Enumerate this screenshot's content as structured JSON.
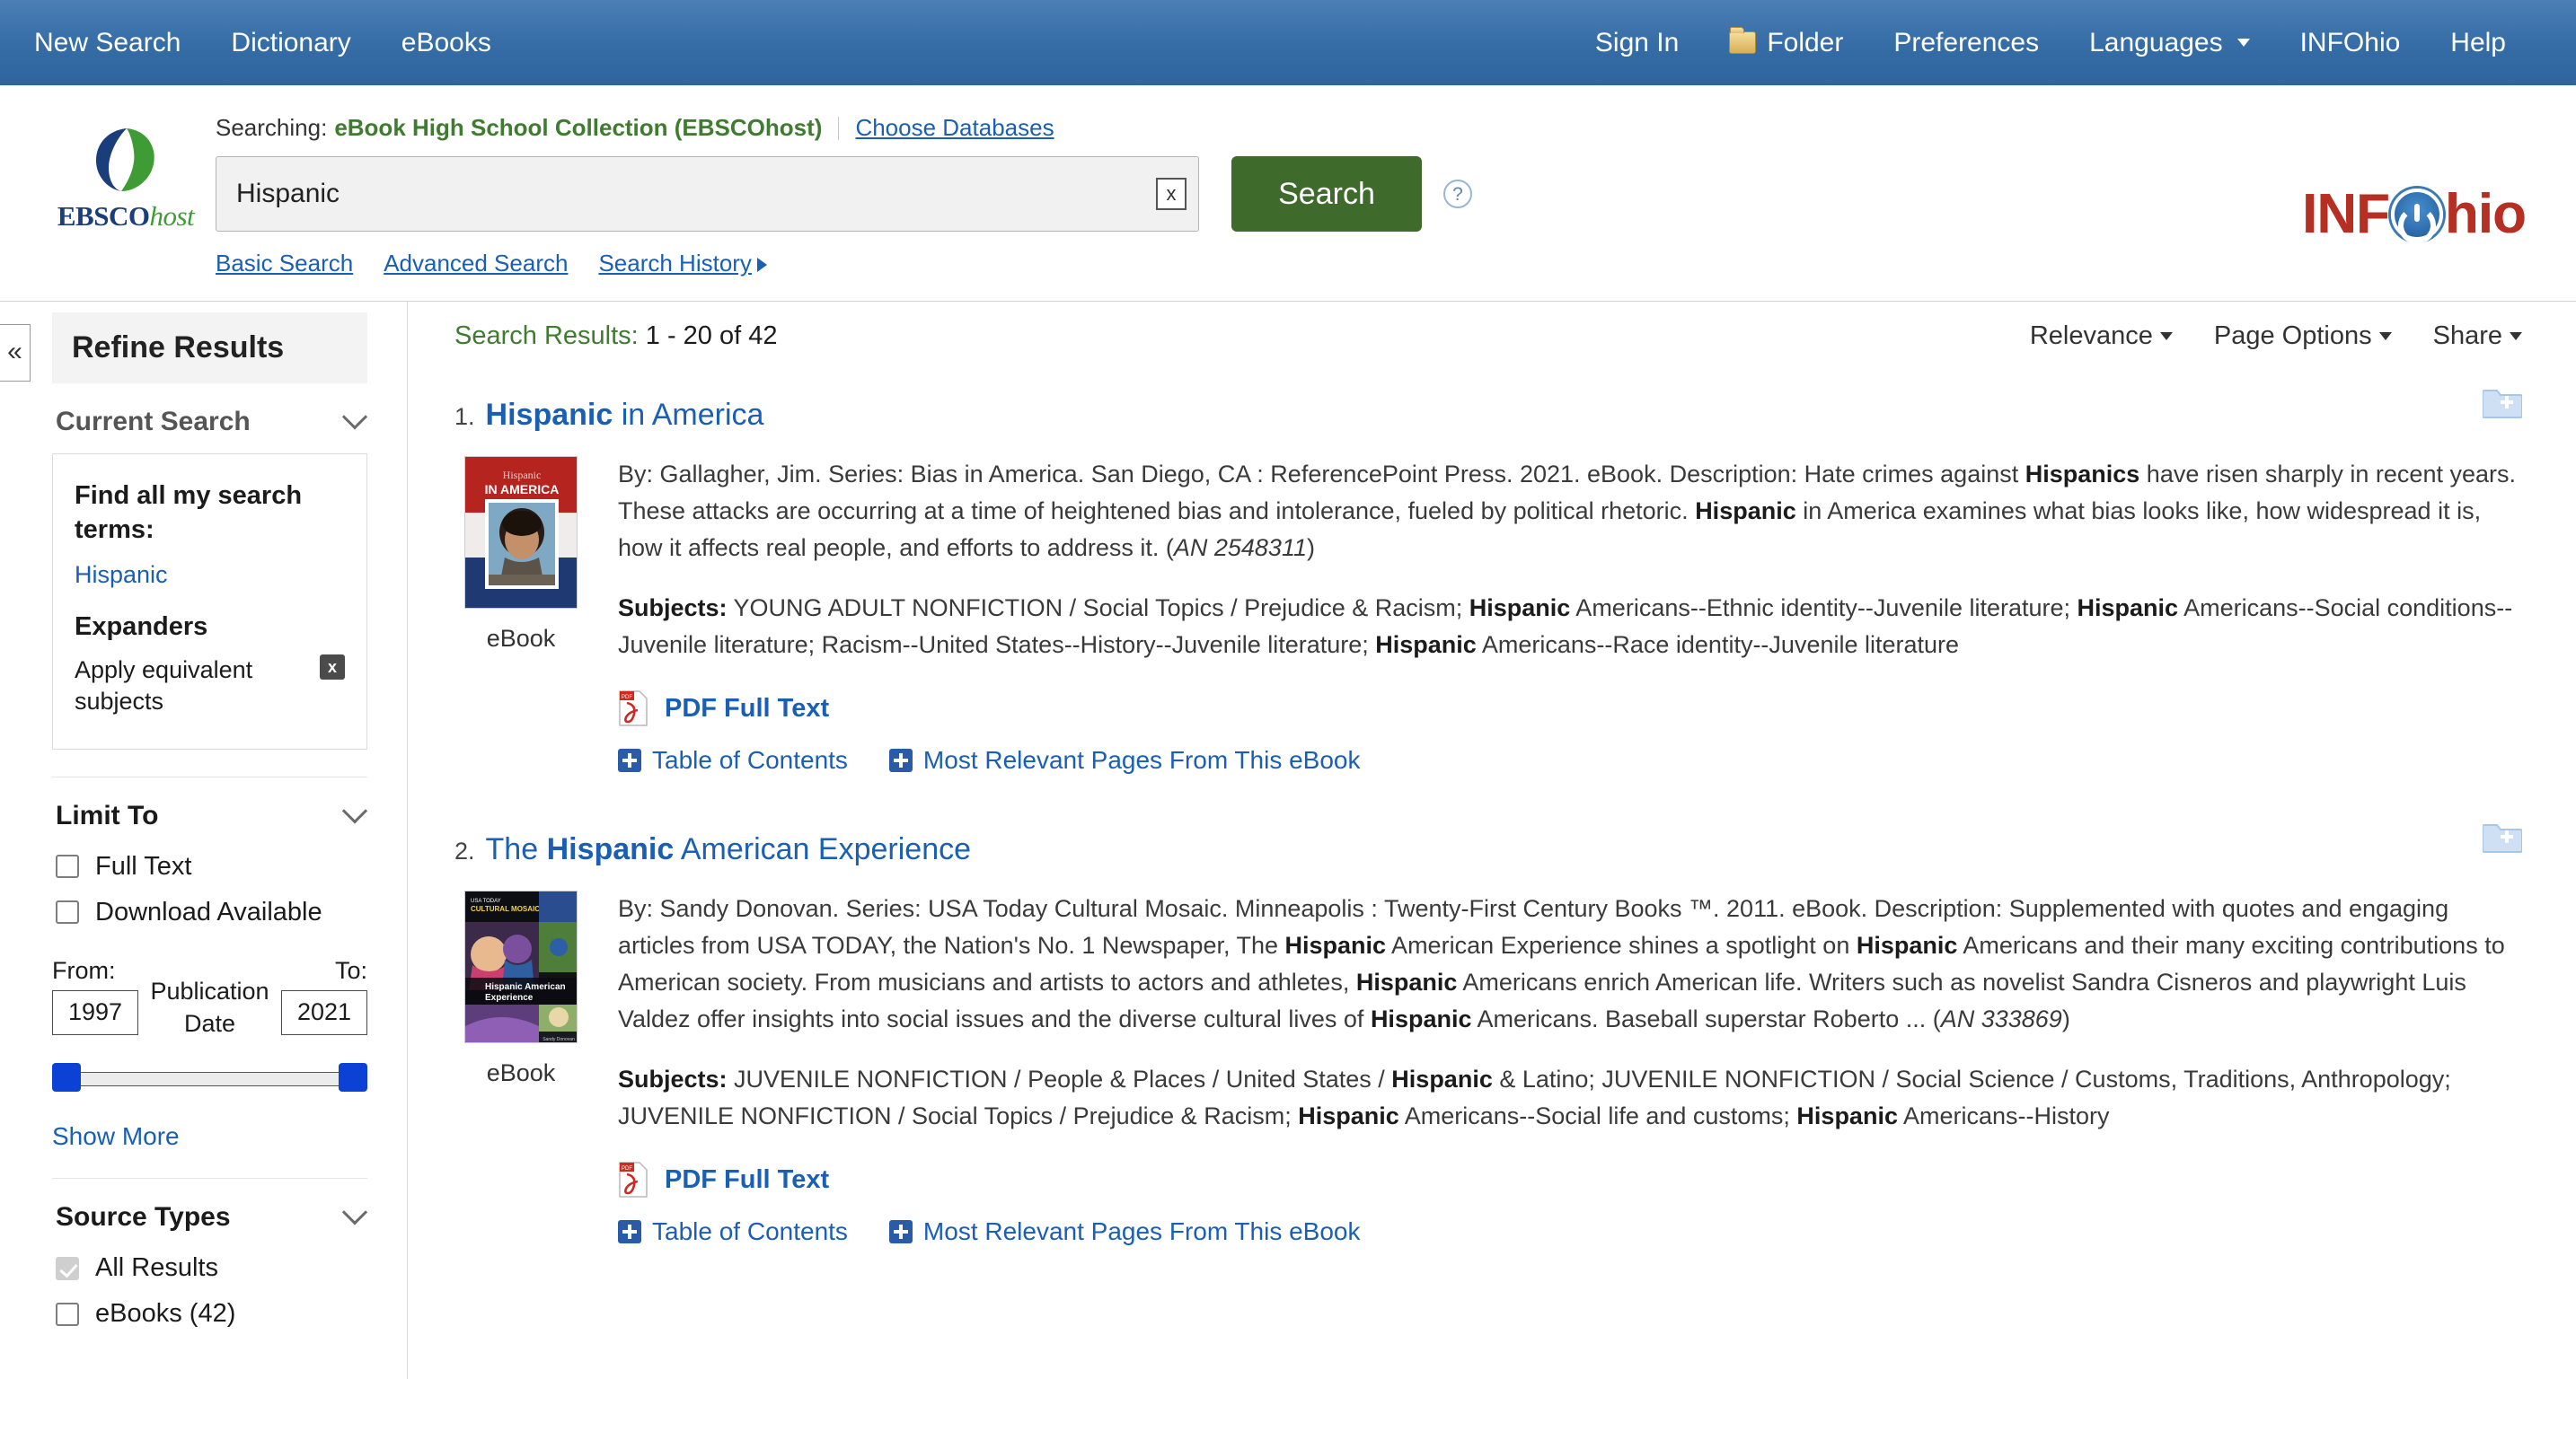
{
  "topnav": {
    "left": [
      {
        "label": "New Search"
      },
      {
        "label": "Dictionary"
      },
      {
        "label": "eBooks"
      }
    ],
    "right": [
      {
        "label": "Sign In",
        "icon": ""
      },
      {
        "label": "Folder",
        "icon": "folder-icon"
      },
      {
        "label": "Preferences",
        "icon": ""
      },
      {
        "label": "Languages",
        "icon": "chevron-down-icon"
      },
      {
        "label": "INFOhio",
        "icon": ""
      },
      {
        "label": "Help",
        "icon": ""
      }
    ]
  },
  "brand": {
    "ebsco_primary": "EBSCO",
    "ebsco_secondary": "host",
    "infohio_part1": "INF",
    "infohio_part2": "hio",
    "accent_green": "#3f7c2f",
    "accent_blue": "#1a5fb4",
    "infohio_red": "#b52f23"
  },
  "search": {
    "searching_label": "Searching:",
    "database": "eBook High School Collection (EBSCOhost)",
    "choose_databases": "Choose Databases",
    "query_value": "Hispanic",
    "query_placeholder": "",
    "clear_label": "x",
    "search_button": "Search",
    "help_label": "?",
    "links": [
      {
        "label": "Basic Search"
      },
      {
        "label": "Advanced Search"
      },
      {
        "label": "Search History"
      }
    ]
  },
  "sidebar": {
    "collapse_label": "«",
    "header": "Refine Results",
    "current_search": {
      "title": "Current Search",
      "find_all_heading": "Find all my search terms:",
      "term": "Hispanic",
      "expanders_heading": "Expanders",
      "expander_item": "Apply equivalent subjects",
      "remove_label": "x"
    },
    "limit_to": {
      "title": "Limit To",
      "checkboxes": [
        {
          "label": "Full Text",
          "checked": false
        },
        {
          "label": "Download Available",
          "checked": false
        }
      ],
      "from_label": "From:",
      "to_label": "To:",
      "from_value": "1997",
      "to_value": "2021",
      "pubdate_label": "Publication Date",
      "show_more": "Show More"
    },
    "source_types": {
      "title": "Source Types",
      "items": [
        {
          "label": "All Results",
          "checked": true
        },
        {
          "label": "eBooks (42)",
          "checked": false
        }
      ]
    }
  },
  "results_toolbar": {
    "results_label": "Search Results:",
    "results_range": "1 - 20 of 42",
    "options": [
      {
        "label": "Relevance"
      },
      {
        "label": "Page Options"
      },
      {
        "label": "Share"
      }
    ]
  },
  "results": [
    {
      "number": "1.",
      "title_prefix": "",
      "title_highlight": "Hispanic",
      "title_suffix": " in America",
      "thumb_label": "eBook",
      "snippet_html": "By: Gallagher, Jim. Series: Bias in America. San Diego, CA : ReferencePoint Press. 2021. eBook. Description: Hate crimes against <b>Hispanics</b> have risen sharply in recent years. These attacks are occurring at a time of heightened bias and intolerance, fueled by political rhetoric. <b>Hispanic</b> in America examines what bias looks like, how widespread it is, how it affects real people, and efforts to address it. (<i>AN 2548311</i>)",
      "subjects_html": "<b>Subjects:</b> YOUNG ADULT NONFICTION / Social Topics / Prejudice &amp; Racism; <b>Hispanic</b> Americans--Ethnic identity--Juvenile literature; <b>Hispanic</b> Americans--Social conditions--Juvenile literature; Racism--United States--History--Juvenile literature; <b>Hispanic</b> Americans--Race identity--Juvenile literature",
      "pdf_label": "PDF Full Text",
      "expanders": [
        {
          "label": "Table of Contents"
        },
        {
          "label": "Most Relevant Pages From This eBook"
        }
      ],
      "add_to_folder": "add-to-folder"
    },
    {
      "number": "2.",
      "title_prefix": "The ",
      "title_highlight": "Hispanic",
      "title_suffix": " American Experience",
      "thumb_label": "eBook",
      "snippet_html": "By: Sandy Donovan. Series: USA Today Cultural Mosaic. Minneapolis : Twenty-First Century Books ™. 2011. eBook. Description: Supplemented with quotes and engaging articles from USA TODAY, the Nation's No. 1 Newspaper, The <b>Hispanic</b> American Experience shines a spotlight on <b>Hispanic</b> Americans and their many exciting contributions to American society. From musicians and artists to actors and athletes, <b>Hispanic</b> Americans enrich American life. Writers such as novelist Sandra Cisneros and playwright Luis Valdez offer insights into social issues and the diverse cultural lives of <b>Hispanic</b> Americans. Baseball superstar Roberto ... (<i>AN 333869</i>)",
      "subjects_html": "<b>Subjects:</b> JUVENILE NONFICTION / People &amp; Places / United States / <b>Hispanic</b> &amp; Latino; JUVENILE NONFICTION / Social Science / Customs, Traditions, Anthropology; JUVENILE NONFICTION / Social Topics / Prejudice &amp; Racism; <b>Hispanic</b> Americans--Social life and customs; <b>Hispanic</b> Americans--History",
      "pdf_label": "PDF Full Text",
      "expanders": [
        {
          "label": "Table of Contents"
        },
        {
          "label": "Most Relevant Pages From This eBook"
        }
      ],
      "add_to_folder": "add-to-folder"
    }
  ]
}
